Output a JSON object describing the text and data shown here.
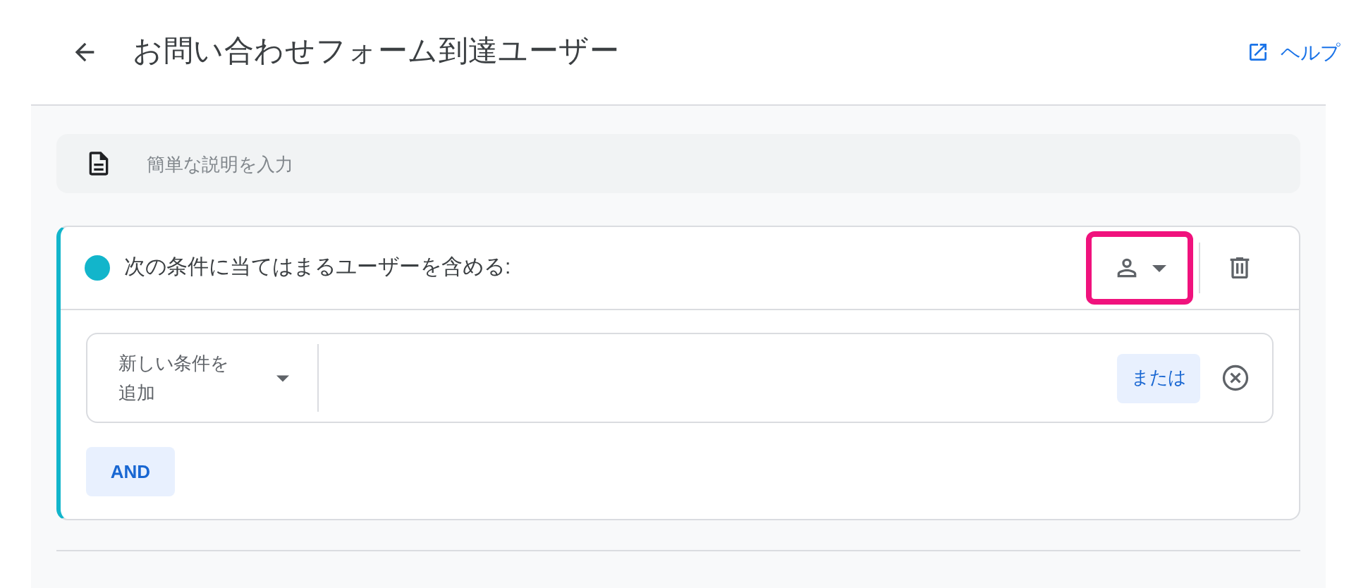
{
  "header": {
    "title": "お問い合わせフォーム到達ユーザー",
    "help_link": "ヘルプ"
  },
  "description": {
    "placeholder": "簡単な説明を入力"
  },
  "condition_group": {
    "color": "#12b5cb",
    "title": "次の条件に当てはまるユーザーを含める:",
    "scope_button": {
      "highlighted": true
    },
    "conditions": [
      {
        "placeholder": "新しい条件を追加",
        "or_button": "または"
      }
    ],
    "and_button": "AND"
  }
}
